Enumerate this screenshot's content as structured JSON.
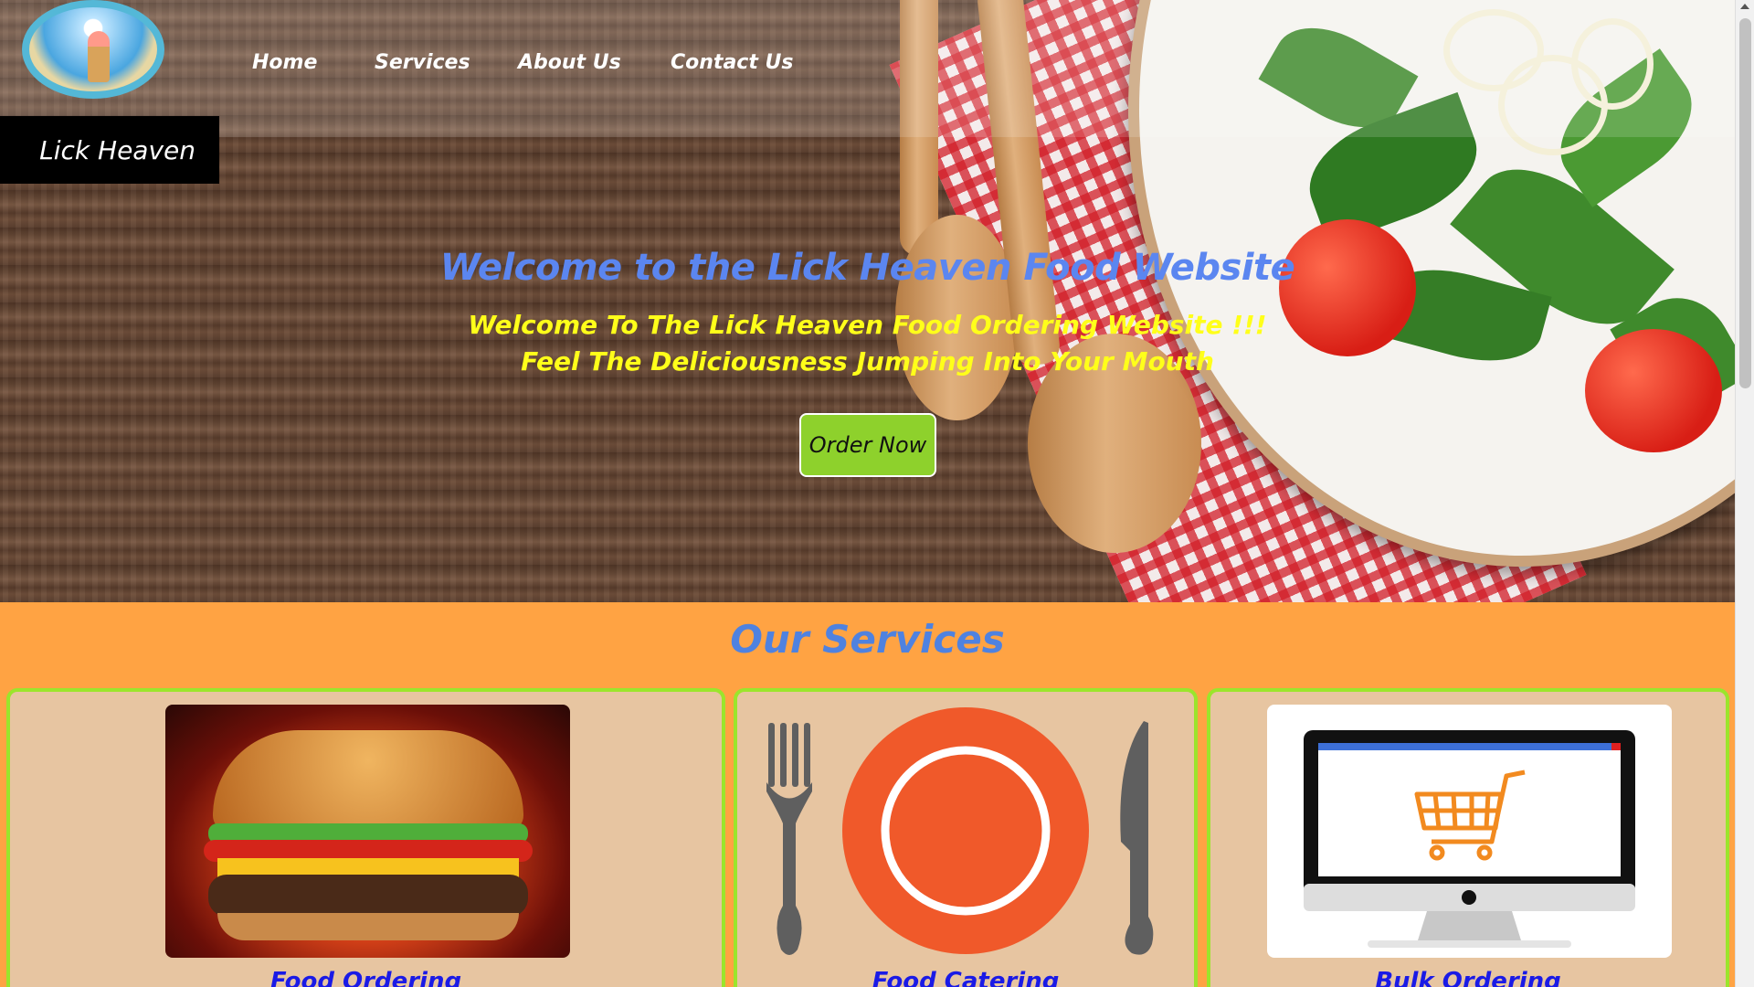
{
  "brand": {
    "name": "Lick Heaven",
    "logo_icon": "ice-cream-beach-logo"
  },
  "nav": {
    "items": [
      {
        "label": "Home"
      },
      {
        "label": "Services"
      },
      {
        "label": "About Us"
      },
      {
        "label": "Contact Us"
      }
    ]
  },
  "hero": {
    "title": "Welcome to the Lick Heaven Food Website",
    "subtitle_line1": "Welcome To The Lick Heaven Food Ordering Website !!!",
    "subtitle_line2": "Feel The Deliciousness Jumping Into Your Mouth",
    "cta_label": "Order Now"
  },
  "services": {
    "title": "Our Services",
    "cards": [
      {
        "label": "Food Ordering",
        "image_icon": "burger-image"
      },
      {
        "label": "Food Catering",
        "image_icon": "plate-fork-knife-image"
      },
      {
        "label": "Bulk Ordering",
        "image_icon": "computer-cart-image"
      }
    ]
  },
  "colors": {
    "hero_title": "#5b86f0",
    "hero_subtitle": "#ffff1a",
    "cta_bg": "#8ed12c",
    "services_bg": "#ffa343",
    "card_bg": "#e7c5a1",
    "card_border": "#9be52c",
    "card_label": "#1a1ae6"
  }
}
